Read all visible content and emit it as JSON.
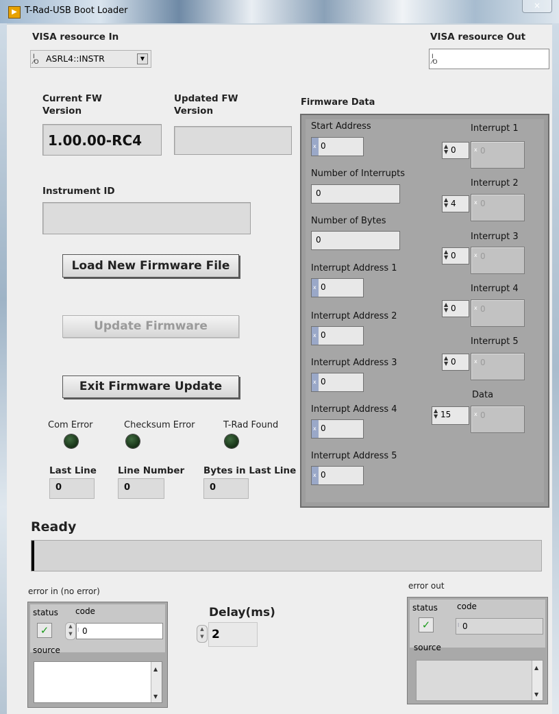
{
  "window": {
    "title": "T-Rad-USB Boot Loader",
    "close_glyph": "×"
  },
  "visa_in": {
    "label": "VISA resource In",
    "value": "ASRL4::INSTR",
    "icon": "visa-io-icon",
    "io_glyph": "I/O"
  },
  "visa_out": {
    "label": "VISA resource Out",
    "value": "",
    "io_glyph": "I/O"
  },
  "fw": {
    "current_label": "Current FW Version",
    "current_value": "1.00.00-RC4",
    "updated_label": "Updated FW Version",
    "updated_value": ""
  },
  "instrument": {
    "label": "Instrument ID",
    "value": ""
  },
  "buttons": {
    "load": "Load New Firmware File",
    "update": "Update Firmware",
    "exit": "Exit Firmware Update"
  },
  "leds": {
    "com_error": "Com Error",
    "checksum_error": "Checksum Error",
    "trad_found": "T-Rad Found"
  },
  "counters": {
    "last_line_label": "Last Line",
    "last_line_value": "0",
    "line_number_label": "Line Number",
    "line_number_value": "0",
    "bytes_last_line_label": "Bytes in Last Line",
    "bytes_last_line_value": "0"
  },
  "firmware_data": {
    "label": "Firmware Data",
    "radix": "x",
    "start_address": {
      "label": "Start Address",
      "value": "0"
    },
    "num_interrupts": {
      "label": "Number of Interrupts",
      "value": "0"
    },
    "num_bytes": {
      "label": "Number of Bytes",
      "value": "0"
    },
    "interrupt_addresses": [
      {
        "label": "Interrupt Address 1",
        "value": "0"
      },
      {
        "label": "Interrupt Address 2",
        "value": "0"
      },
      {
        "label": "Interrupt Address 3",
        "value": "0"
      },
      {
        "label": "Interrupt Address 4",
        "value": "0"
      },
      {
        "label": "Interrupt Address 5",
        "value": "0"
      }
    ],
    "interrupts": [
      {
        "label": "Interrupt 1",
        "index": "0",
        "value": "0"
      },
      {
        "label": "Interrupt 2",
        "index": "4",
        "value": "0"
      },
      {
        "label": "Interrupt 3",
        "index": "0",
        "value": "0"
      },
      {
        "label": "Interrupt 4",
        "index": "0",
        "value": "0"
      },
      {
        "label": "Interrupt 5",
        "index": "0",
        "value": "0"
      }
    ],
    "data": {
      "label": "Data",
      "index": "15",
      "value": "0"
    }
  },
  "status": {
    "label": "Ready",
    "value": ""
  },
  "error_in": {
    "label": "error in (no error)",
    "status_label": "status",
    "code_label": "code",
    "code_value": "0",
    "source_label": "source",
    "source_value": "",
    "check": "✓"
  },
  "delay": {
    "label": "Delay(ms)",
    "value": "2"
  },
  "error_out": {
    "label": "error out",
    "status_label": "status",
    "code_label": "code",
    "code_value": "0",
    "source_label": "source",
    "source_value": "",
    "check": "✓"
  }
}
